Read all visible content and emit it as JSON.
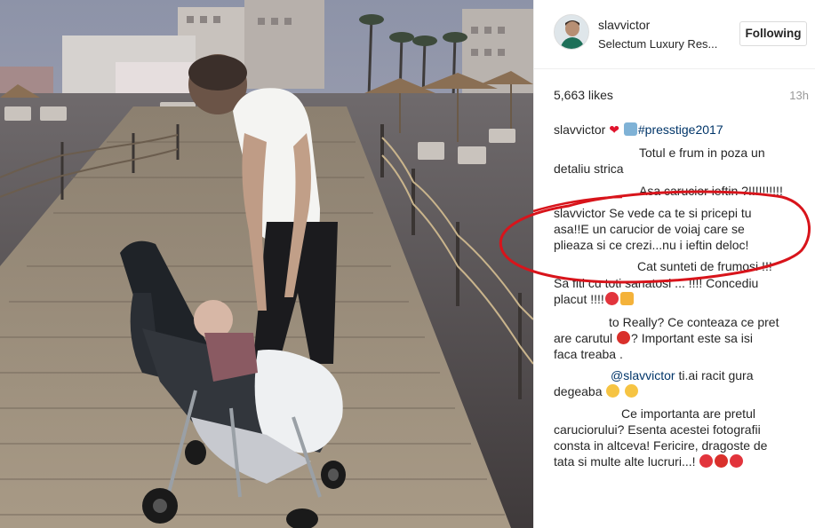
{
  "header": {
    "username": "slavvictor",
    "location": "Selectum Luxury Res...",
    "follow_label": "Following"
  },
  "stats": {
    "likes": "5,663 likes",
    "time": "13h"
  },
  "caption": {
    "user": "slavvictor",
    "hashtag": "#presstige2017"
  },
  "comments": {
    "c1_l1": "Totul e frum in poza un",
    "c1_l2": "detaliu strica",
    "c2_l1": "Asa carucior ieftin ?!!!!!!!!!!",
    "c3_user": "slavvictor",
    "c3_l1": "Se vede ca te si pricepi tu",
    "c3_l2": "asa!!E un carucior de voiaj care se",
    "c3_l3": "plieaza si ce crezi...nu i ieftin deloc!",
    "c4_l1": "Cat sunteti de frumosi !!!",
    "c4_l2": "Sa fiti cu toti sanatosi ... !!!! Concediu",
    "c4_l3": "placut !!!!",
    "c5_l1a": "to",
    "c5_l1b": "Really? Ce conteaza ce pret",
    "c5_l2a": "are carutul",
    "c5_l2b": "? Important este sa isi",
    "c5_l3": "faca treaba .",
    "c6_mention": "@slavvictor",
    "c6_l1": "ti.ai racit gura",
    "c6_l2": "degeaba",
    "c7_l1": "Ce importanta are pretul",
    "c7_l2": "caruciorului? Esenta acestei fotografii",
    "c7_l3": "consta in altceva! Fericire, dragoste de",
    "c7_l4": "tata si multe alte lucruri...!"
  },
  "colors": {
    "annotation_circle": "#d8141b",
    "link": "#003569",
    "text": "#262626",
    "muted": "#999999"
  },
  "icons": {
    "heart": "red-heart-icon",
    "person": "person-emoji-icon",
    "heart_ribbon": "heart-ribbon-icon",
    "thumbs_up": "thumbs-up-icon",
    "angry": "angry-face-icon",
    "grin": "grinning-sweat-icon"
  }
}
